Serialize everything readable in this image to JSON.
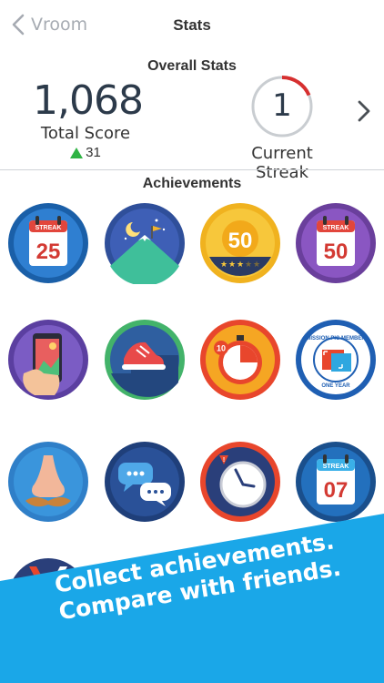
{
  "nav": {
    "back_label": "Vroom",
    "title": "Stats"
  },
  "overall": {
    "heading": "Overall Stats",
    "total_score": "1,068",
    "total_score_label": "Total Score",
    "score_delta": "31",
    "current_streak": "1",
    "current_streak_label": "Current Streak"
  },
  "achievements": {
    "heading": "Achievements",
    "badges": [
      {
        "name": "streak-25-badge",
        "calendar_label": "STREAK",
        "number": "25"
      },
      {
        "name": "mountain-moon-badge"
      },
      {
        "name": "score-50-badge",
        "number": "50",
        "stars_filled": 3,
        "stars_total": 5
      },
      {
        "name": "streak-50-badge",
        "calendar_label": "STREAK",
        "number": "50"
      },
      {
        "name": "phone-photo-badge"
      },
      {
        "name": "sneaker-step-badge"
      },
      {
        "name": "timer-10-badge",
        "number": "10"
      },
      {
        "name": "mission-pic-member-badge",
        "ring_text_top": "MISSION PIC MEMBER",
        "ring_text_bottom": "ONE YEAR"
      },
      {
        "name": "nose-mustache-badge"
      },
      {
        "name": "chat-bubbles-badge"
      },
      {
        "name": "alarm-clock-badge"
      },
      {
        "name": "streak-07-badge",
        "calendar_label": "STREAK",
        "number": "07"
      }
    ]
  },
  "promo": {
    "line1": "Collect achievements.",
    "line2": "Compare with friends."
  },
  "colors": {
    "promo_blue": "#1aa7e8",
    "streak_arc": "#d62f2f",
    "delta_green": "#2fb344"
  }
}
